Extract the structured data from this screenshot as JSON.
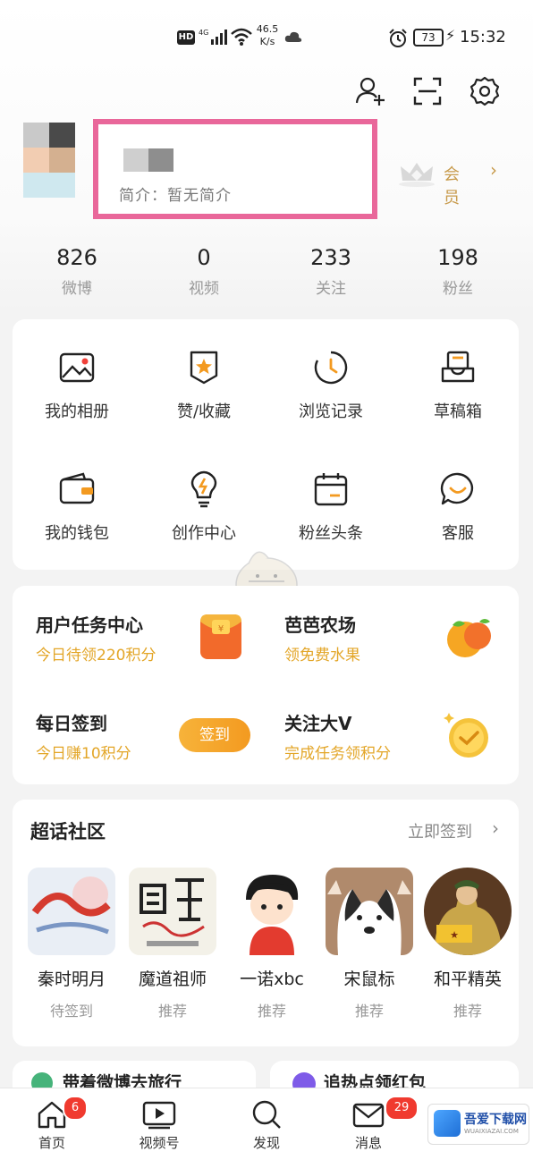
{
  "status_bar": {
    "hd": "HD",
    "network": "4G",
    "speed_value": "46.5",
    "speed_unit": "K/s",
    "battery": "73",
    "time": "15:32"
  },
  "header_icons": [
    "add-user-icon",
    "scan-icon",
    "settings-icon"
  ],
  "profile": {
    "bio": "简介：暂无简介",
    "vip_label": "会员",
    "vip_chevron": "›"
  },
  "stats": [
    {
      "value": "826",
      "label": "微博"
    },
    {
      "value": "0",
      "label": "视频"
    },
    {
      "value": "233",
      "label": "关注"
    },
    {
      "value": "198",
      "label": "粉丝"
    }
  ],
  "grid": [
    {
      "label": "我的相册",
      "icon": "album-icon"
    },
    {
      "label": "赞/收藏",
      "icon": "favorite-icon"
    },
    {
      "label": "浏览记录",
      "icon": "history-icon"
    },
    {
      "label": "草稿箱",
      "icon": "drafts-icon"
    },
    {
      "label": "我的钱包",
      "icon": "wallet-icon"
    },
    {
      "label": "创作中心",
      "icon": "lightbulb-icon"
    },
    {
      "label": "粉丝头条",
      "icon": "calendar-icon"
    },
    {
      "label": "客服",
      "icon": "chat-icon"
    }
  ],
  "tasks": [
    {
      "title": "用户任务中心",
      "sub": "今日待领220积分"
    },
    {
      "title": "芭芭农场",
      "sub": "领免费水果"
    },
    {
      "title": "每日签到",
      "sub": "今日赚10积分",
      "button": "签到"
    },
    {
      "title": "关注大V",
      "sub": "完成任务领积分"
    }
  ],
  "super_topic": {
    "title": "超话社区",
    "link": "立即签到",
    "chevron": "›",
    "items": [
      {
        "name": "秦时明月",
        "status": "待签到"
      },
      {
        "name": "魔道祖师",
        "status": "推荐"
      },
      {
        "name": "一诺xbc",
        "status": "推荐"
      },
      {
        "name": "宋鼠标",
        "status": "推荐"
      },
      {
        "name": "和平精英",
        "status": "推荐"
      }
    ]
  },
  "peek": {
    "left": "带着微博去旅行",
    "right": "追热点领红包"
  },
  "bottom_nav": {
    "items": [
      {
        "label": "首页",
        "icon": "home-icon",
        "badge": "6"
      },
      {
        "label": "视频号",
        "icon": "video-icon"
      },
      {
        "label": "发现",
        "icon": "search-icon"
      },
      {
        "label": "消息",
        "icon": "mail-icon",
        "badge": "29"
      }
    ]
  },
  "watermark": {
    "text": "吾爱下载网",
    "sub": "WUAIXIAZAI.COM"
  },
  "colors": {
    "accent": "#f39a20",
    "highlight_box": "#e9679a",
    "task_sub": "#e3a628",
    "badge": "#f03a2f",
    "vip": "#c79a4b"
  }
}
